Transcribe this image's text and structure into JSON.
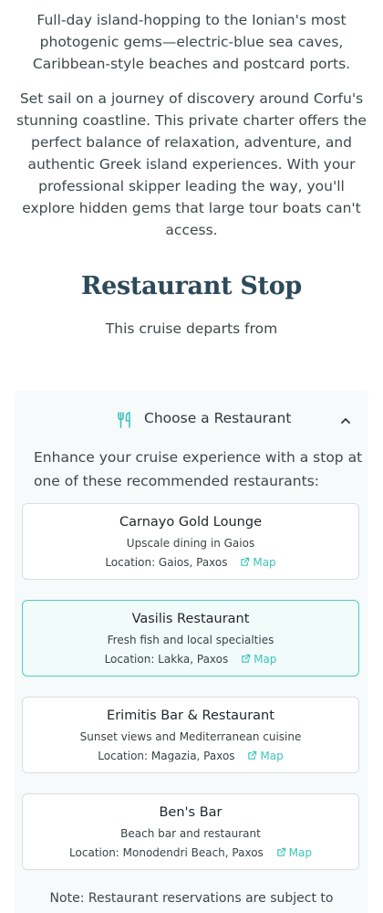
{
  "intro": {
    "lead": "Full-day island-hopping to the Ionian's most photogenic gems—electric-blue sea caves, Caribbean-style beaches and postcard ports.",
    "body": "Set sail on a journey of discovery around Corfu's stunning coastline. This private charter offers the perfect balance of relaxation, adventure, and authentic Greek island experiences. With your professional skipper leading the way, you'll explore hidden gems that large tour boats can't access."
  },
  "restaurant_section": {
    "title": "Restaurant Stop",
    "departs_text": "This cruise departs from",
    "panel": {
      "icon": "fork-knife-icon",
      "title": "Choose a Restaurant",
      "toggle_icon": "chevron-up-icon",
      "description": "Enhance your cruise experience with a stop at one of these recommended restaurants:",
      "map_label": "Map",
      "location_prefix": "Location:",
      "restaurants": [
        {
          "name": "Carnayo Gold Lounge",
          "description": "Upscale dining in Gaios",
          "location": "Location: Gaios, Paxos",
          "map": "Map",
          "selected": false
        },
        {
          "name": "Vasilis Restaurant",
          "description": "Fresh fish and local specialties",
          "location": "Location: Lakka, Paxos",
          "map": "Map",
          "selected": true
        },
        {
          "name": "Erimitis Bar & Restaurant",
          "description": "Sunset views and Mediterranean cuisine",
          "location": "Location: Magazia, Paxos",
          "map": "Map",
          "selected": false
        },
        {
          "name": "Ben's Bar",
          "description": "Beach bar and restaurant",
          "location": "Location: Monodendri Beach, Paxos",
          "map": "Map",
          "selected": false
        }
      ],
      "note": "Note: Restaurant reservations are subject to"
    }
  },
  "colors": {
    "accent": "#3ec4bc",
    "selected_border": "#4ecdc4",
    "selected_bg": "#f1fbfa",
    "title": "#2d4a5a",
    "panel_bg": "#f7fafb"
  }
}
